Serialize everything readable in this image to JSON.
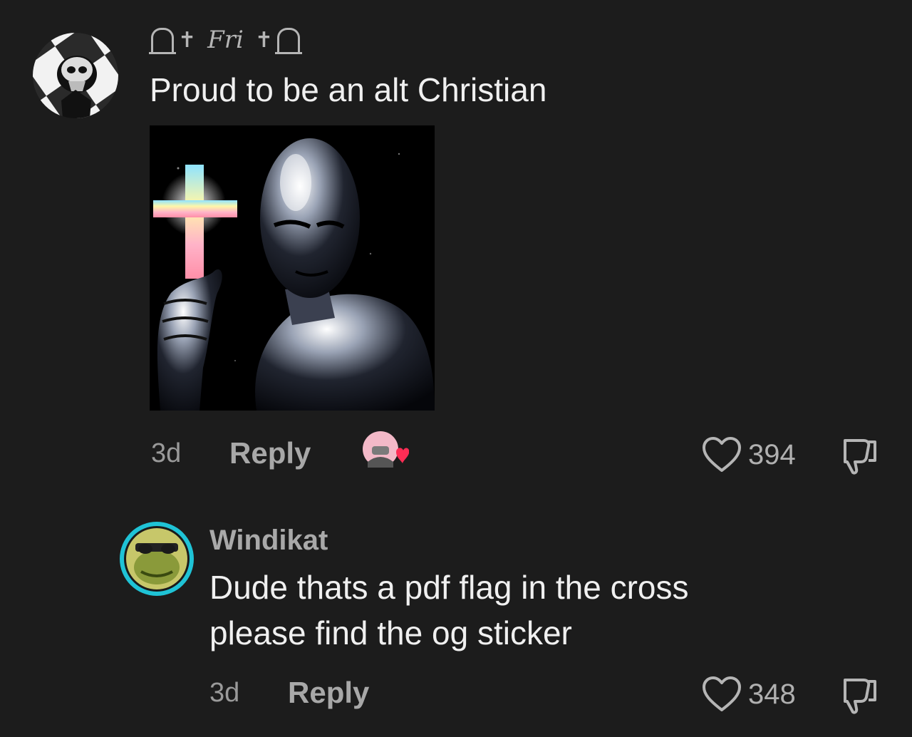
{
  "comments": [
    {
      "username": "Fri",
      "text": "Proud to be an alt Christian",
      "time": "3d",
      "reply_label": "Reply",
      "likes": "394"
    },
    {
      "username": "Windikat",
      "text_line1": "Dude thats a pdf flag in the cross",
      "text_line2": "please find the og sticker",
      "time": "3d",
      "reply_label": "Reply",
      "likes": "348"
    }
  ],
  "icons": {
    "like": "heart-outline-icon",
    "dislike": "thumbs-down-icon"
  },
  "colors": {
    "background": "#1c1c1c",
    "text": "#f0f0f0",
    "muted": "#9a9a9a",
    "liked_by_creator_heart": "#ff2d55",
    "avatar_ring": "#1fc3d6"
  }
}
